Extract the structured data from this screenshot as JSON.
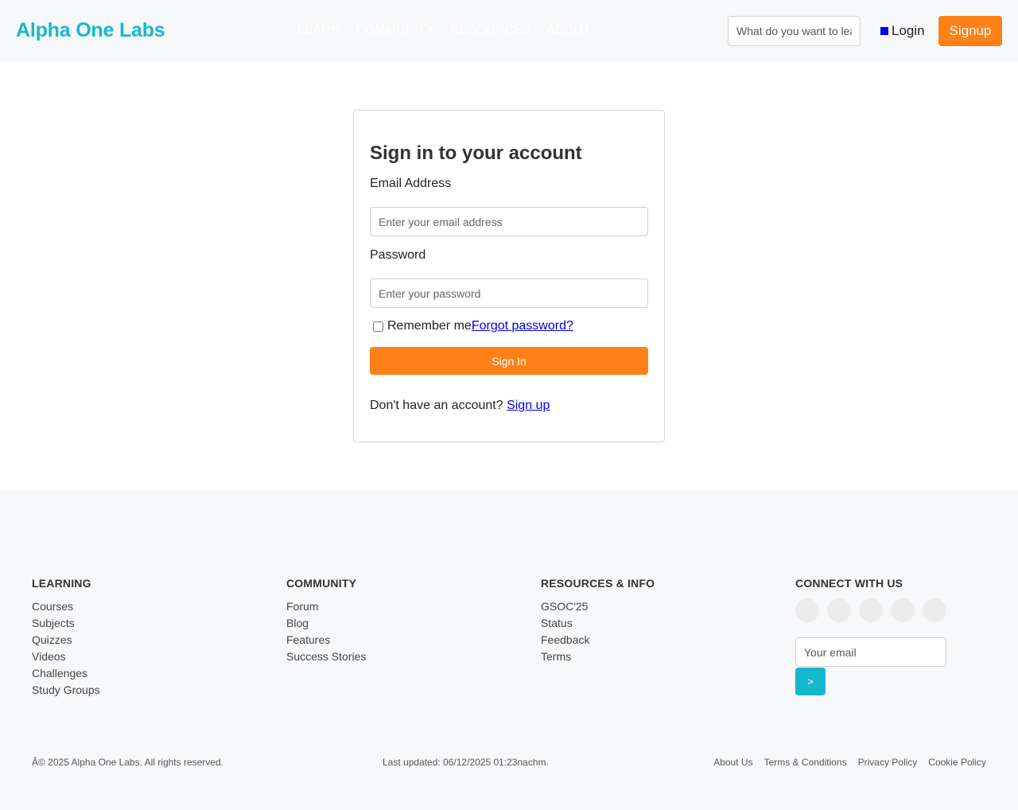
{
  "header": {
    "logo": "Alpha One Labs",
    "nav": [
      "LEARN",
      "COMMUNITY",
      "RESOURCES",
      "ABOUT"
    ],
    "search_placeholder": "What do you want to learn?",
    "login_label": "Login",
    "signup_label": "Signup"
  },
  "signin": {
    "title": "Sign in to your account",
    "email_label": "Email Address",
    "email_placeholder": "Enter your email address",
    "password_label": "Password",
    "password_placeholder": "Enter your password",
    "remember_label": "Remember me",
    "forgot_label": "Forgot password?",
    "submit_label": "Sign In",
    "no_account_text": "Don't have an account?",
    "signup_link": "Sign up"
  },
  "footer": {
    "learning": {
      "title": "LEARNING",
      "items": [
        "Courses",
        "Subjects",
        "Quizzes",
        "Videos",
        "Challenges",
        "Study Groups"
      ]
    },
    "community": {
      "title": "COMMUNITY",
      "items": [
        "Forum",
        "Blog",
        "Features",
        "Success Stories"
      ]
    },
    "resources": {
      "title": "RESOURCES & INFO",
      "items": [
        "GSOC'25",
        "Status",
        "Feedback",
        "Terms"
      ]
    },
    "connect": {
      "title": "CONNECT WITH US",
      "email_placeholder": "Your email",
      "submit_label": ">"
    },
    "copyright": "Â© 2025 Alpha One Labs. All rights reserved.",
    "last_updated": "Last updated: 06/12/2025 01:23nachm.",
    "bottom_links": [
      "About Us",
      "Terms & Conditions",
      "Privacy Policy",
      "Cookie Policy"
    ]
  },
  "colors": {
    "brand": "#17b8cc",
    "accent": "#fd8116",
    "link": "#0000ee"
  }
}
